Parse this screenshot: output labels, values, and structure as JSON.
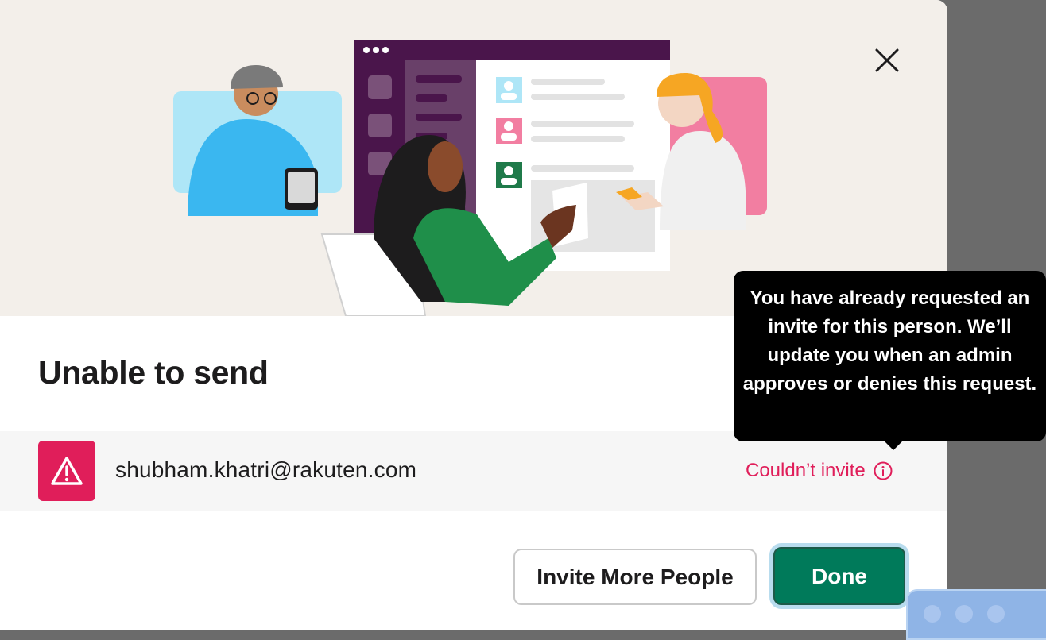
{
  "dialog": {
    "title": "Unable to send",
    "close_icon": "close-icon"
  },
  "invite_result": {
    "email": "shubham.khatri@rakuten.com",
    "status_label": "Couldn’t invite",
    "warning_icon": "warning-triangle-icon",
    "info_icon": "info-circle-icon"
  },
  "tooltip": {
    "text": "You have already requested an invite for this person. We’ll update you when an admin approves or denies this request."
  },
  "buttons": {
    "invite_more_label": "Invite More People",
    "done_label": "Done"
  },
  "colors": {
    "danger": "#e01e5a",
    "primary": "#007a5a",
    "aubergine": "#4a154b"
  }
}
